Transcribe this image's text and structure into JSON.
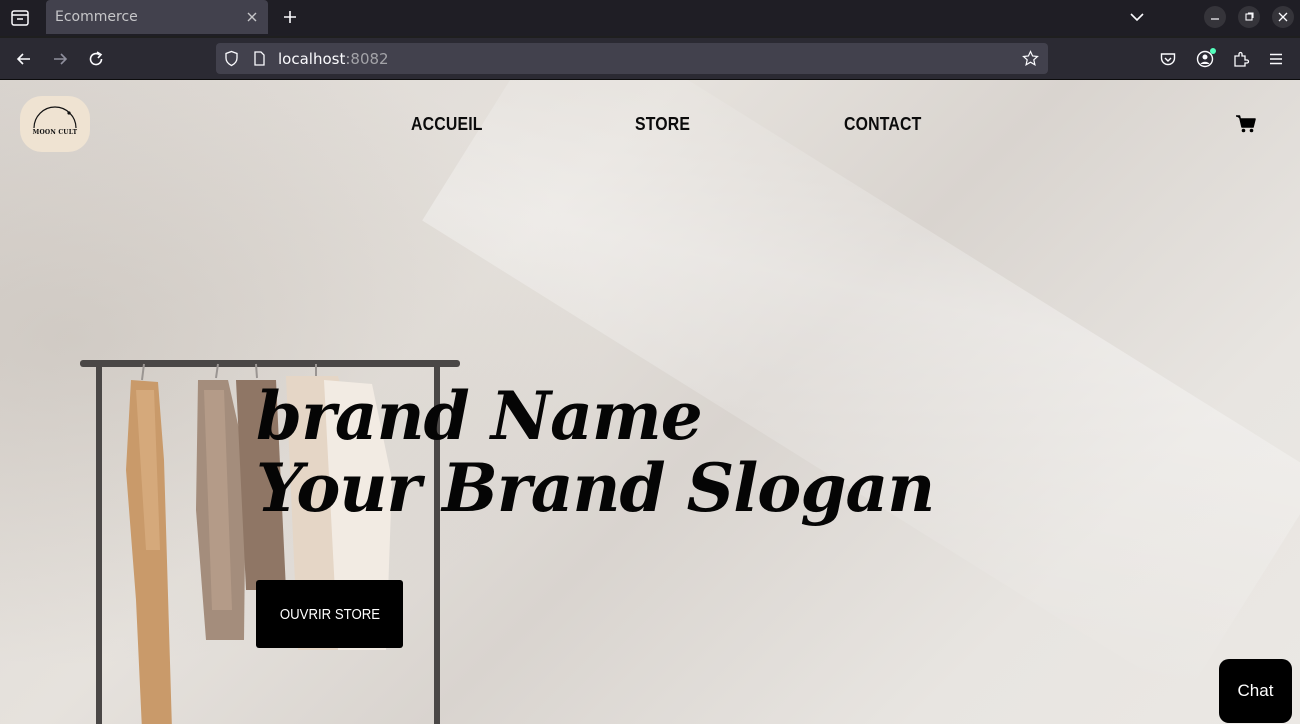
{
  "browser": {
    "tab_title": "Ecommerce",
    "url_host": "localhost",
    "url_port": ":8082"
  },
  "site": {
    "logo_text": "MOON CULT",
    "nav": {
      "home": "ACCUEIL",
      "store": "STORE",
      "contact": "CONTACT"
    },
    "hero": {
      "line1": "brand Name",
      "line2": "Your Brand Slogan",
      "cta": "OUVRIR STORE"
    },
    "chat_label": "Chat"
  },
  "icons": [
    "tab-list-icon",
    "close-icon",
    "plus-icon",
    "chevron-down-icon",
    "minimize-icon",
    "restore-icon",
    "back-icon",
    "forward-icon",
    "reload-icon",
    "shield-icon",
    "page-icon",
    "star-icon",
    "pocket-icon",
    "account-icon",
    "extensions-icon",
    "menu-icon",
    "cart-icon"
  ],
  "colors": {
    "page_bg": "#e3dfda",
    "button_bg": "#000000",
    "button_text": "#ffffff",
    "logo_bg": "#efe3d2"
  }
}
